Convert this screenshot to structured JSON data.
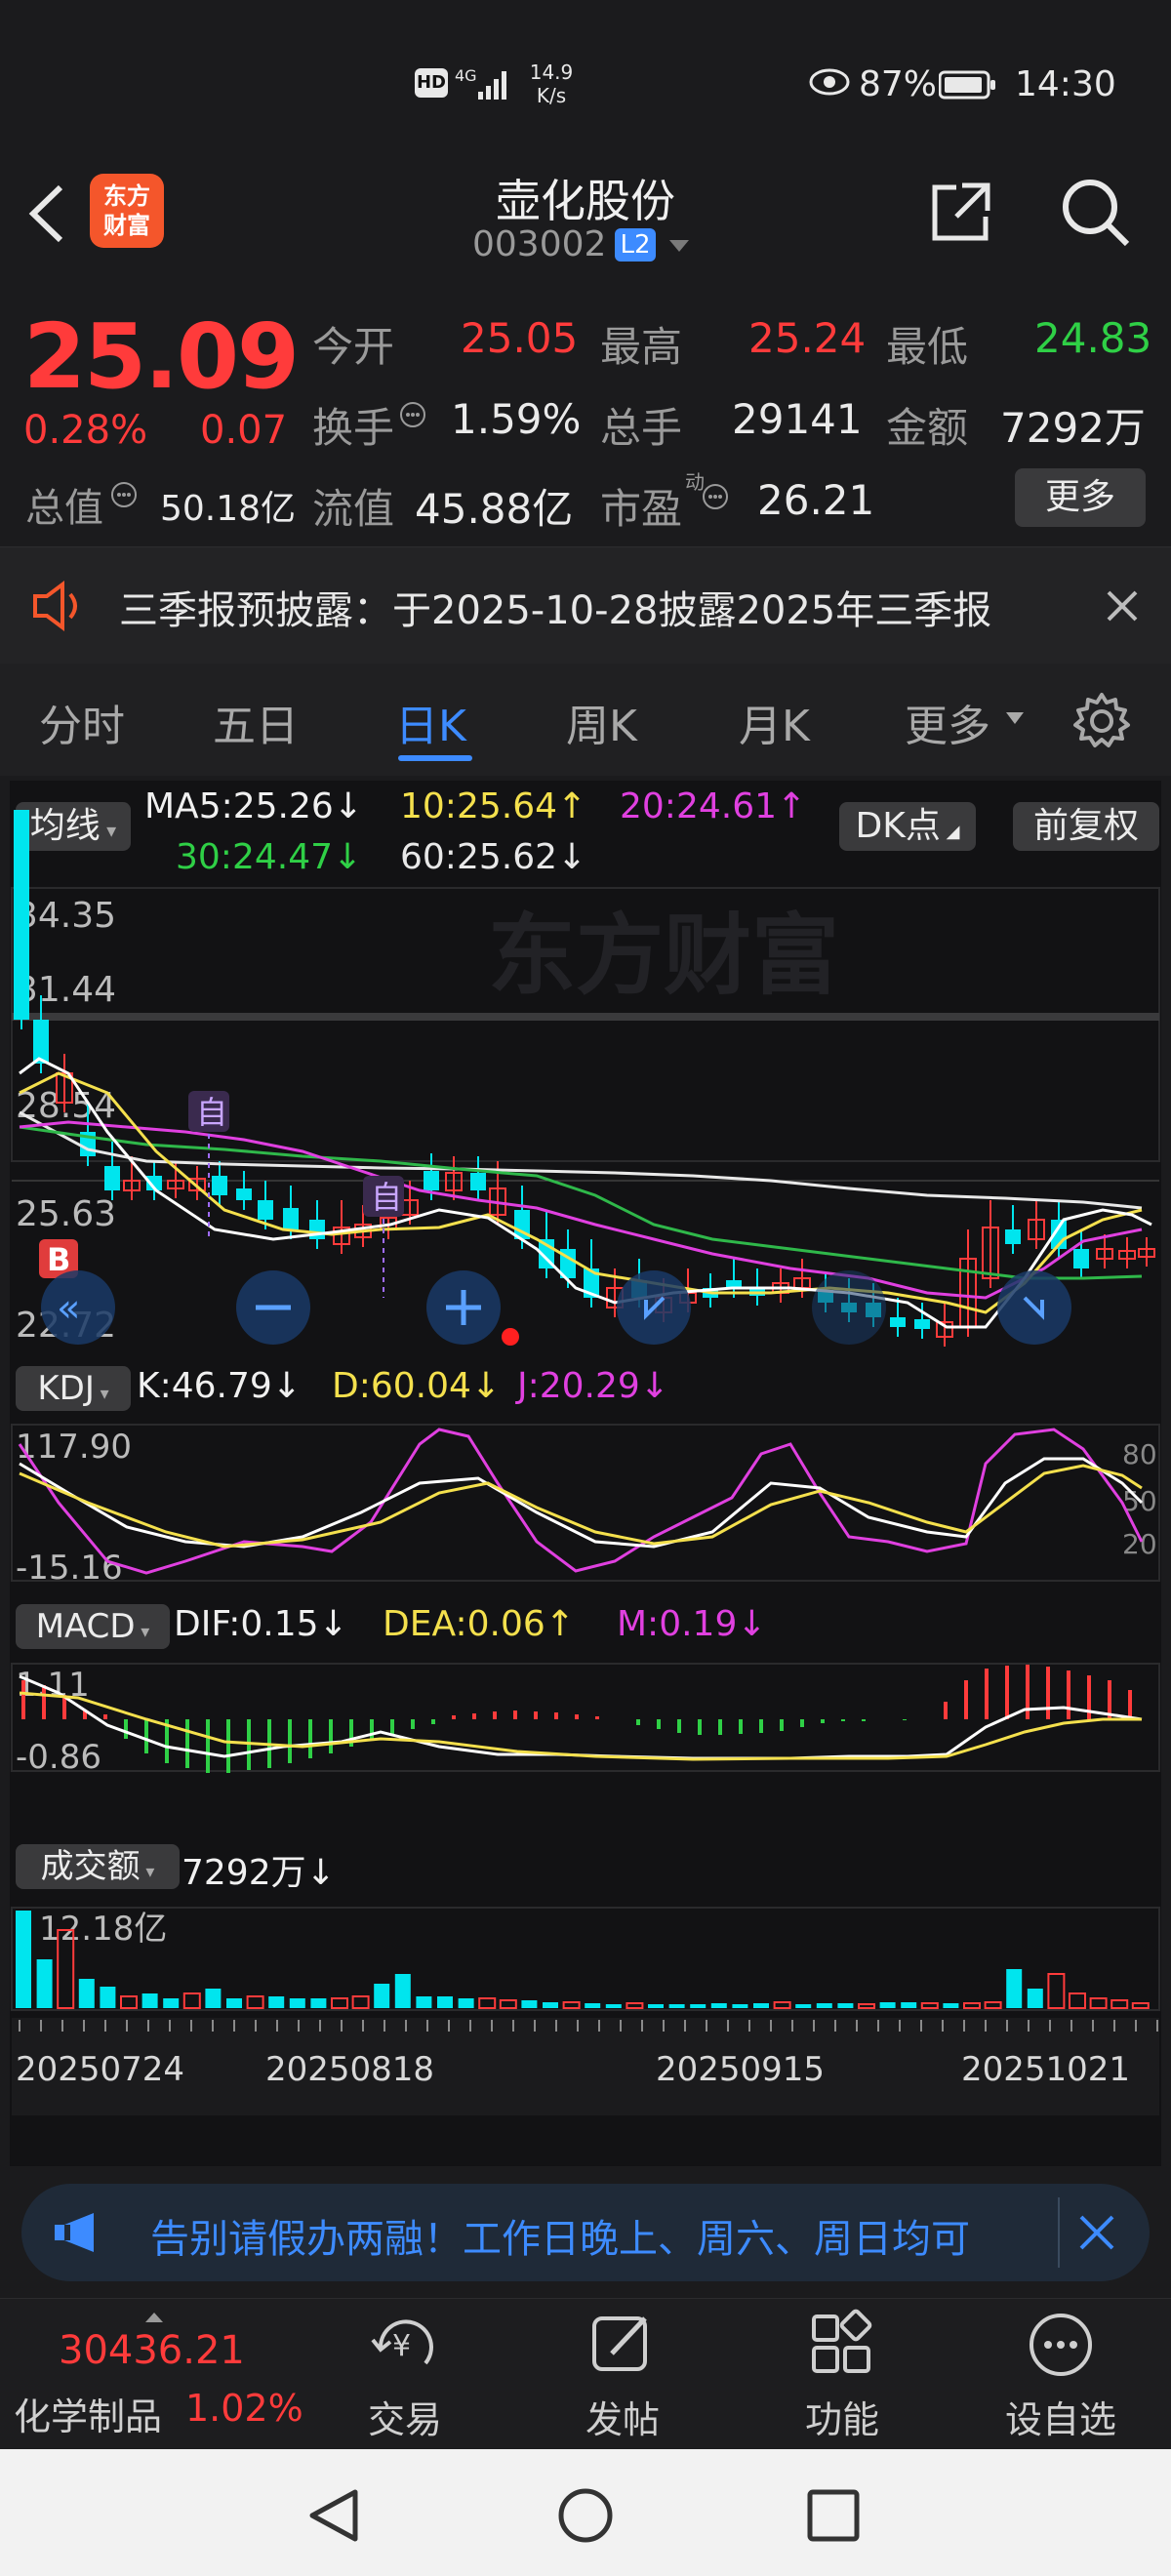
{
  "status": {
    "net_speed_top": "14.9",
    "net_speed_bottom": "K/s",
    "signal": "4G",
    "battery": "87%",
    "time": "14:30"
  },
  "header": {
    "title": "壶化股份",
    "code": "003002",
    "level_badge": "L2",
    "logo_line1": "东方",
    "logo_line2": "财富"
  },
  "quote": {
    "price": "25.09",
    "change_pct": "0.28%",
    "change_amt": "0.07",
    "open_label": "今开",
    "open": "25.05",
    "high_label": "最高",
    "high": "25.24",
    "low_label": "最低",
    "low": "24.83",
    "turnover_label": "换手",
    "turnover": "1.59%",
    "volume_label": "总手",
    "volume": "29141",
    "amount_label": "金额",
    "amount": "7292万",
    "mktcap_label": "总值",
    "mktcap": "50.18亿",
    "float_label": "流值",
    "float": "45.88亿",
    "pe_label": "市盈",
    "pe_super": "动",
    "pe": "26.21",
    "more": "更多"
  },
  "notice": {
    "text": "三季报预披露：于2025-10-28披露2025年三季报"
  },
  "tabs": [
    "分时",
    "五日",
    "日K",
    "周K",
    "月K",
    "更多"
  ],
  "ma": {
    "selector": "均线",
    "ma5": "MA5:25.26↓",
    "ma10": "10:25.64↑",
    "ma20": "20:24.61↑",
    "ma30": "30:24.47↓",
    "ma60": "60:25.62↓",
    "dk": "DK点",
    "adjust": "前复权"
  },
  "kchart": {
    "y_top": "34.35",
    "y_2": "31.44",
    "y_3": "28.54",
    "y_4": "25.63",
    "y_bottom": "22.72",
    "marker_label": "自",
    "b_label": "B",
    "watermark": "东方财富"
  },
  "kdj": {
    "selector": "KDJ",
    "k": "K:46.79↓",
    "d": "D:60.04↓",
    "j": "J:20.29↓",
    "y_top": "117.90",
    "y_bottom": "-15.16",
    "r80": "80",
    "r50": "50",
    "r20": "20"
  },
  "macd": {
    "selector": "MACD",
    "dif": "DIF:0.15↓",
    "dea": "DEA:0.06↑",
    "m": "M:0.19↓",
    "y_top": "1.11",
    "y_bottom": "-0.86"
  },
  "vol": {
    "selector": "成交额",
    "value": "7292万↓",
    "y_top": "12.18亿"
  },
  "dates": [
    "20250724",
    "20250818",
    "20250915",
    "20251021"
  ],
  "ad": {
    "text": "告别请假办两融！工作日晚上、周六、周日均可"
  },
  "bottom": {
    "index_value": "30436.21",
    "index_name": "化学制品",
    "index_pct": "1.02%",
    "trade": "交易",
    "post": "发帖",
    "func": "功能",
    "watch": "设自选"
  },
  "colors": {
    "up": "#ff3b3b",
    "down": "#00e5ee",
    "ma5": "#ffffff",
    "ma10": "#f4e04d",
    "ma20": "#e040e0",
    "ma30": "#2fb84a",
    "ma60": "#e8e8e8",
    "accent": "#3d8bff"
  }
}
